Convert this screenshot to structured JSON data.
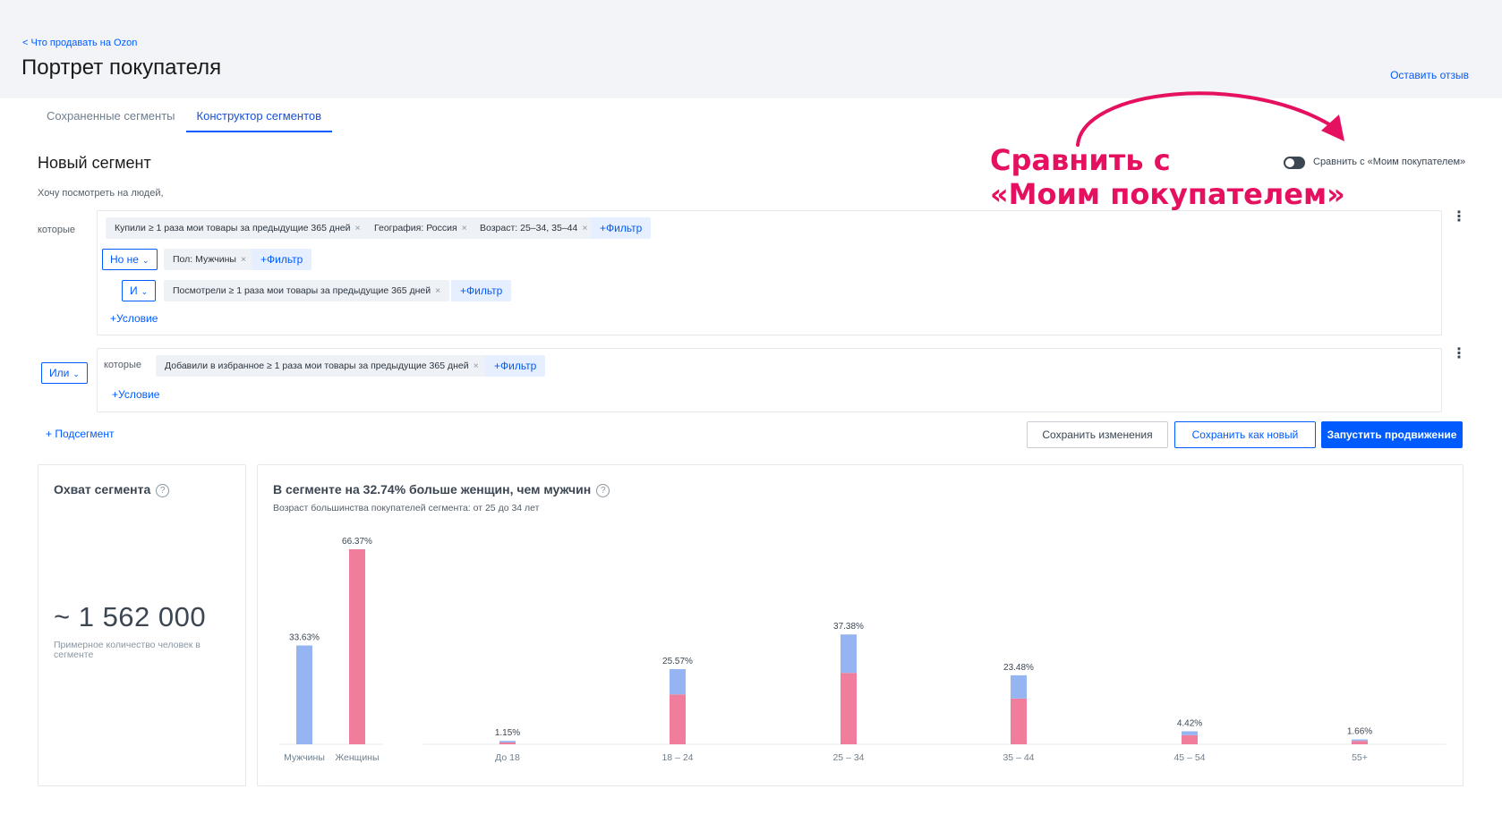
{
  "header": {
    "back_link": "< Что продавать на Ozon",
    "title": "Портрет покупателя",
    "feedback": "Оставить отзыв"
  },
  "tabs": [
    {
      "label": "Сохраненные сегменты",
      "active": false
    },
    {
      "label": "Конструктор сегментов",
      "active": true
    }
  ],
  "segment": {
    "title": "Новый сегмент",
    "hint": "Хочу посмотреть на людей,"
  },
  "annotation": {
    "line1": "Сравнить с",
    "line2": "«Моим покупателем»",
    "color": "#e5105f"
  },
  "compare_toggle": {
    "label": "Сравнить с «Моим покупателем»",
    "on": false
  },
  "group1": {
    "which_label": "которые",
    "row1_chips": [
      "Купили ≥ 1 раза мои товары за предыдущие 365 дней",
      "География: Россия",
      "Возраст: 25–34, 35–44"
    ],
    "row2_logic": "Но не",
    "row2_chips": [
      "Пол: Мужчины"
    ],
    "row3_logic": "И",
    "row3_chips": [
      "Посмотрели ≥ 1 раза мои товары за предыдущие 365 дней"
    ],
    "filter_label": "+Фильтр",
    "condition_label": "+Условие"
  },
  "group2": {
    "logic": "Или",
    "which_label": "которые",
    "chips": [
      "Добавили в избранное ≥ 1 раза мои товары за предыдущие 365 дней"
    ],
    "filter_label": "+Фильтр",
    "condition_label": "+Условие"
  },
  "subsegment_label": "+ Подсегмент",
  "actions": {
    "save": "Сохранить изменения",
    "save_new": "Сохранить как новый",
    "launch": "Запустить продвижение"
  },
  "reach": {
    "title": "Охват сегмента",
    "help": "?",
    "value": "~ 1 562 000",
    "caption": "Примерное количество человек в сегменте"
  },
  "demographics": {
    "title": "В сегменте на 32.74% больше женщин, чем мужчин",
    "help": "?",
    "subtitle": "Возраст большинства покупателей сегмента: от 25 до 34 лет"
  },
  "colors": {
    "accent": "#005bff",
    "male": "#94b5f2",
    "female": "#f07d9b"
  },
  "chart_data": {
    "type": "bar",
    "gender": {
      "categories": [
        "Мужчины",
        "Женщины"
      ],
      "values": [
        33.63,
        66.37
      ],
      "labels": [
        "33.63%",
        "66.37%"
      ]
    },
    "age": {
      "categories": [
        "До 18",
        "18 – 24",
        "25 – 34",
        "35 – 44",
        "45 – 54",
        "55+"
      ],
      "totals": [
        1.15,
        25.57,
        37.38,
        23.48,
        4.42,
        1.66
      ],
      "labels": [
        "1.15%",
        "25.57%",
        "37.38%",
        "23.48%",
        "4.42%",
        "1.66%"
      ],
      "series": [
        {
          "values": [
            0.55,
            8.6,
            13.1,
            7.9,
            1.3,
            0.5
          ]
        },
        {
          "values": [
            0.6,
            16.97,
            24.28,
            15.58,
            3.12,
            1.16
          ]
        }
      ]
    },
    "stack_order": [
      "female",
      "male"
    ],
    "grid": false,
    "legend": "none"
  }
}
